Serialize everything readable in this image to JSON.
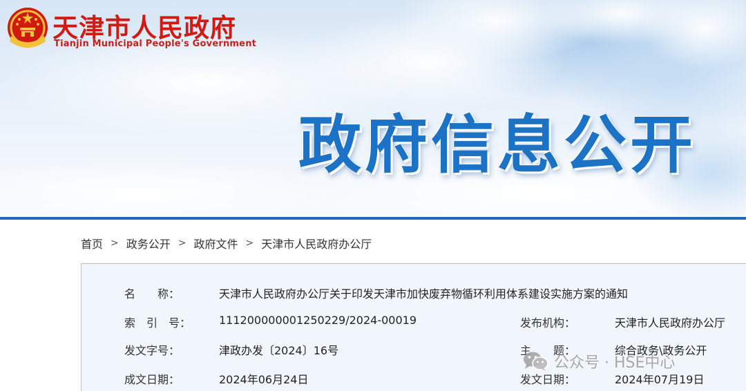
{
  "site": {
    "name_cn": "天津市人民政府",
    "name_en": "Tianjin Municipal People's Government",
    "logo_icon": "national-emblem-icon"
  },
  "banner": {
    "headline": "政府信息公开"
  },
  "breadcrumb": {
    "items": [
      "首页",
      "政务公开",
      "政府文件",
      "天津市人民政府办公厅"
    ],
    "separator": ">"
  },
  "document_info": {
    "name_label": "名　　称：",
    "name_value": "天津市人民政府办公厅关于印发天津市加快废弃物循环利用体系建设实施方案的通知",
    "index_label": "索　引　号：",
    "index_value": "11120000000125022​9/2024-00019",
    "issuer_label": "发布机构：",
    "issuer_value": "天津市人民政府办公厅",
    "doc_number_label": "发文字号：",
    "doc_number_value": "津政办发〔2024〕16号",
    "topic_label": "主　　题：",
    "topic_value": "综合政务\\政务公开",
    "created_label": "成文日期：",
    "created_value": "2024年06月24日",
    "published_label": "发文日期：",
    "published_value": "2024年07月19日"
  },
  "watermark": {
    "text": "公众号 · HSE中心",
    "icon": "wechat-icon"
  },
  "colors": {
    "brand_red": "#d01a12",
    "headline_blue": "#1c72c5",
    "rule_blue": "#1d6bb8",
    "panel_bg": "#f1f6fc",
    "panel_border": "#a7c4e4"
  }
}
